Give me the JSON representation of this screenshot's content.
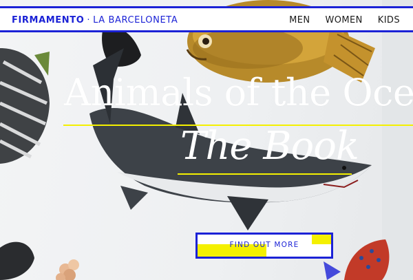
{
  "header": {
    "brand_name": "FIRMAMENTO",
    "brand_separator": "·",
    "brand_location": "LA BARCELONETA",
    "nav": [
      "MEN",
      "WOMEN",
      "KIDS"
    ]
  },
  "hero": {
    "title": "Animals of the Oce",
    "subtitle": "The Book",
    "cta_label": "FIND OUT MORE"
  },
  "colors": {
    "accent_blue": "#1b22d6",
    "highlight_yellow": "#f4f000",
    "title_text": "#ffffff"
  },
  "icons": [
    "sunfish-illustration",
    "shark-illustration",
    "striped-fish-illustration",
    "coral-illustration",
    "red-spotted-fish-illustration",
    "fish-illustration"
  ]
}
